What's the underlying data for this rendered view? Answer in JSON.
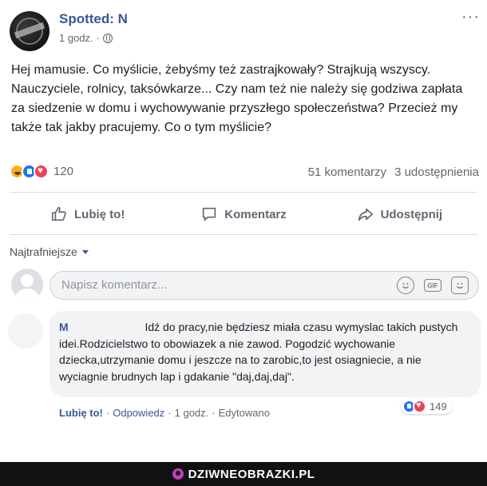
{
  "post": {
    "page_name": "Spotted: N",
    "time": "1 godz.",
    "separator": "·",
    "more_label": "···",
    "text": "Hej mamusie. Co myślicie, żebyśmy też zastrajkowały? Strajkują wszyscy. Nauczyciele, rolnicy, taksówkarze... Czy nam też nie należy się godziwa zapłata za siedzenie w domu i wychowywanie przyszłego społeczeństwa? Przecież my także tak jakby pracujemy. Co o tym myślicie?",
    "reaction_icons": [
      "haha-icon",
      "like-icon",
      "love-icon"
    ],
    "reaction_count": "120",
    "comments_count": "51 komentarzy",
    "shares_count": "3 udostępnienia"
  },
  "actions": {
    "like": "Lubię to!",
    "comment": "Komentarz",
    "share": "Udostępnij"
  },
  "comments": {
    "sort_label": "Najtrafniejsze",
    "input_placeholder": "Napisz komentarz...",
    "input_icons": [
      "emoji-icon",
      "gif-icon",
      "sticker-icon"
    ],
    "gif_label": "GIF",
    "top_comment": {
      "author": "M",
      "text": "Idź do pracy,nie będziesz miała czasu wymyslac takich pustych idei.Rodzicielstwo to obowiazek a nie zawod. Pogodzić wychowanie dziecka,utrzymanie domu i jeszcze na to zarobic,to jest osiagniecie, a nie wyciagnie brudnych lap i gdakanie \"daj,daj,daj\".",
      "like_label": "Lubię to!",
      "reply_label": "Odpowiedz",
      "time": "1 godz.",
      "edited_label": "Edytowano",
      "dot": "·",
      "reaction_icons": [
        "like-icon",
        "love-icon"
      ],
      "reaction_count": "149"
    }
  },
  "footer": {
    "brand": "DZIWNEOBRAZKI.PL"
  },
  "colors": {
    "link_blue": "#365899",
    "like_blue": "#1877f2",
    "love_red": "#f33e58",
    "haha_yellow": "#f7b125",
    "footer_bg": "#111111",
    "footer_accent": "#c23dbf"
  }
}
